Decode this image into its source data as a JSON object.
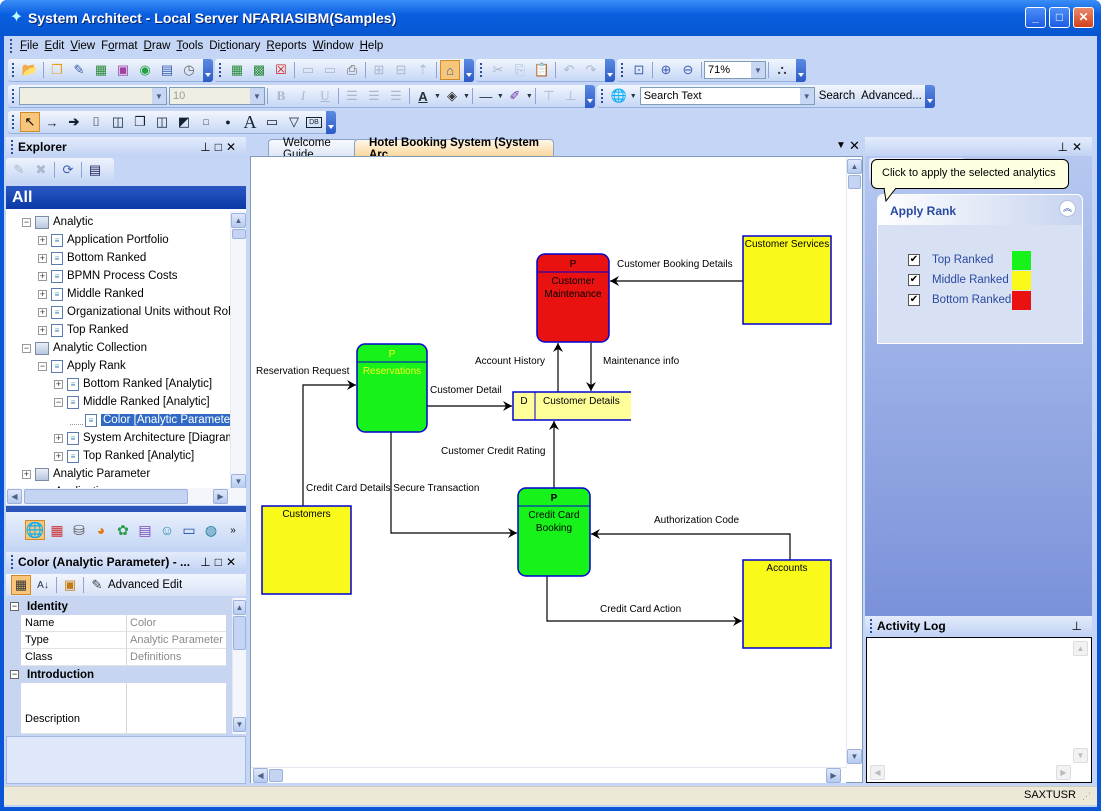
{
  "window": {
    "title": "System Architect - Local Server NFARIASIBM(Samples)",
    "controls": {
      "minimize": "_",
      "maximize": "□",
      "close": "✕"
    }
  },
  "menu": [
    {
      "label": "File",
      "accel": "F"
    },
    {
      "label": "Edit",
      "accel": "E"
    },
    {
      "label": "View",
      "accel": "V"
    },
    {
      "label": "Format",
      "accel": "o"
    },
    {
      "label": "Draw",
      "accel": "D"
    },
    {
      "label": "Tools",
      "accel": "T"
    },
    {
      "label": "Dictionary",
      "accel": "c"
    },
    {
      "label": "Reports",
      "accel": "R"
    },
    {
      "label": "Window",
      "accel": "W"
    },
    {
      "label": "Help",
      "accel": "H"
    }
  ],
  "toolbar": {
    "zoom_value": "71%",
    "font_name": "",
    "font_size": "10",
    "search_placeholder": "Search Text",
    "search_label": "Search",
    "advanced_label": "Advanced...",
    "bold": "B",
    "italic": "I",
    "underline": "U",
    "text_tool": "A",
    "db_tool": "DB"
  },
  "explorer": {
    "title": "Explorer",
    "scope": "All",
    "items": [
      {
        "label": "Analytic",
        "level": 0,
        "expander": "−",
        "icon": "folder"
      },
      {
        "label": "Application Portfolio",
        "level": 1,
        "expander": "+",
        "icon": "doc"
      },
      {
        "label": "Bottom Ranked",
        "level": 1,
        "expander": "+",
        "icon": "doc"
      },
      {
        "label": "BPMN Process Costs",
        "level": 1,
        "expander": "+",
        "icon": "doc"
      },
      {
        "label": "Middle Ranked",
        "level": 1,
        "expander": "+",
        "icon": "doc"
      },
      {
        "label": "Organizational Units without Role",
        "level": 1,
        "expander": "+",
        "icon": "doc"
      },
      {
        "label": "Top Ranked",
        "level": 1,
        "expander": "+",
        "icon": "doc"
      },
      {
        "label": "Analytic Collection",
        "level": 0,
        "expander": "−",
        "icon": "folder"
      },
      {
        "label": "Apply Rank",
        "level": 1,
        "expander": "−",
        "icon": "doc"
      },
      {
        "label": "Bottom Ranked  [Analytic]",
        "level": 2,
        "expander": "+",
        "icon": "doc"
      },
      {
        "label": "Middle Ranked  [Analytic]",
        "level": 2,
        "expander": "−",
        "icon": "doc"
      },
      {
        "label": "Color  [Analytic Parameter]",
        "level": 3,
        "expander": "",
        "icon": "doc",
        "selected": true
      },
      {
        "label": "System Architecture  [Diagram",
        "level": 2,
        "expander": "+",
        "icon": "doc"
      },
      {
        "label": "Top Ranked  [Analytic]",
        "level": 2,
        "expander": "+",
        "icon": "doc"
      },
      {
        "label": "Analytic Parameter",
        "level": 0,
        "expander": "+",
        "icon": "folder"
      },
      {
        "label": "Application",
        "level": 0,
        "expander": "+",
        "icon": "db"
      }
    ]
  },
  "properties": {
    "title": "Color (Analytic Parameter) - ...",
    "advanced_edit_label": "Advanced Edit",
    "categories": [
      {
        "name": "Identity",
        "rows": [
          {
            "key": "Name",
            "value": "Color"
          },
          {
            "key": "Type",
            "value": "Analytic Parameter"
          },
          {
            "key": "Class",
            "value": "Definitions"
          }
        ]
      },
      {
        "name": "Introduction",
        "rows": [
          {
            "key": "Description",
            "value": ""
          }
        ]
      }
    ]
  },
  "tabs": [
    {
      "label": "Welcome Guide",
      "active": false
    },
    {
      "label": "Hotel Booking System (System Arc...",
      "active": true
    }
  ],
  "diagram": {
    "processes": [
      {
        "id": "cust-maint",
        "header": "P",
        "name": "Customer Maintenance",
        "lines": [
          "Customer",
          "Maintenance"
        ],
        "rank": "bottom"
      },
      {
        "id": "reservations",
        "header": "P",
        "name": "Reservations",
        "lines": [
          "Reservations"
        ],
        "rank": "top"
      },
      {
        "id": "cc-booking",
        "header": "P",
        "name": "Credit Card Booking",
        "lines": [
          "Credit Card",
          "Booking"
        ],
        "rank": "top"
      }
    ],
    "externals": [
      {
        "id": "cust-services",
        "name": "Customer Services"
      },
      {
        "id": "customers",
        "name": "Customers"
      },
      {
        "id": "accounts",
        "name": "Accounts"
      }
    ],
    "datastore": {
      "id": "cust-details",
      "tag": "D",
      "name": "Customer Details"
    },
    "flows": [
      {
        "label": "Customer Booking Details",
        "from": "cust-services",
        "to": "cust-maint"
      },
      {
        "label": "Account History",
        "from": "cust-details",
        "to": "cust-maint"
      },
      {
        "label": "Maintenance info",
        "from": "cust-maint",
        "to": "cust-details"
      },
      {
        "label": "Reservation Request",
        "from": "customers",
        "to": "reservations"
      },
      {
        "label": "Customer Detail",
        "from": "reservations",
        "to": "cust-details"
      },
      {
        "label": "Customer Credit Rating",
        "from": "cc-booking",
        "to": "cust-details"
      },
      {
        "label": "Credit Card Details Secure Transaction",
        "from": "reservations",
        "to": "cc-booking"
      },
      {
        "label": "Authorization Code",
        "from": "accounts",
        "to": "cc-booking"
      },
      {
        "label": "Credit Card Action",
        "from": "cc-booking",
        "to": "accounts"
      }
    ]
  },
  "analytics": {
    "tooltip": "Click to apply the selected analytics",
    "panel_title": "Apply Rank",
    "ranks": [
      {
        "label": "Top Ranked",
        "checked": true,
        "color": "#17f31a"
      },
      {
        "label": "Middle Ranked",
        "checked": true,
        "color": "#fafa1a"
      },
      {
        "label": "Bottom Ranked",
        "checked": true,
        "color": "#ea1111"
      }
    ]
  },
  "activity_log": {
    "title": "Activity Log"
  },
  "status": {
    "user": "SAXTUSR"
  },
  "colors": {
    "top": "#17f31a",
    "middle": "#fafa1a",
    "bottom": "#ea1111",
    "datastore": "#ffff99",
    "border": "#0000d0",
    "selection": "#316ac5"
  }
}
